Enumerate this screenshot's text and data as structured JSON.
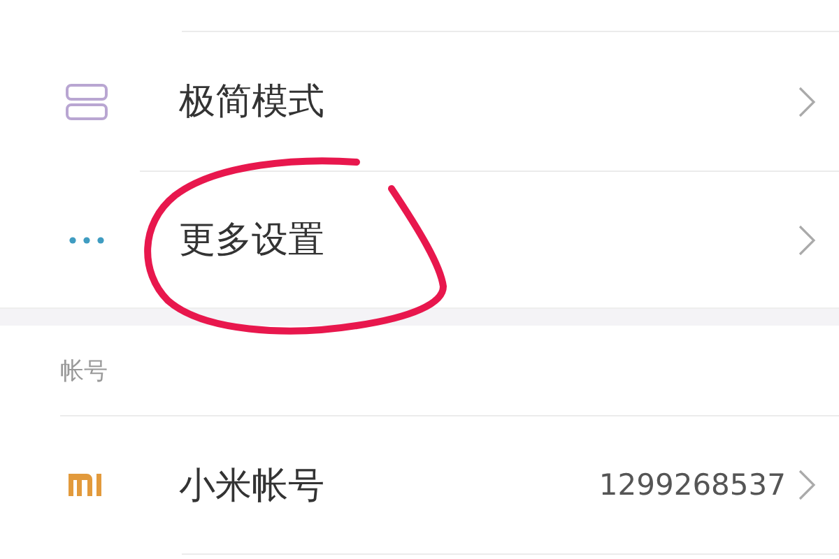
{
  "settings_rows": [
    {
      "kind": "stack",
      "label": "极简模式"
    },
    {
      "kind": "dots",
      "label": "更多设置"
    }
  ],
  "account_section": {
    "title": "帐号",
    "rows": [
      {
        "kind": "logo",
        "label": "小米帐号",
        "value": "1299268537"
      }
    ]
  },
  "annotations": [
    {
      "kind": "freehand-circle",
      "color": "#e8174d"
    }
  ]
}
